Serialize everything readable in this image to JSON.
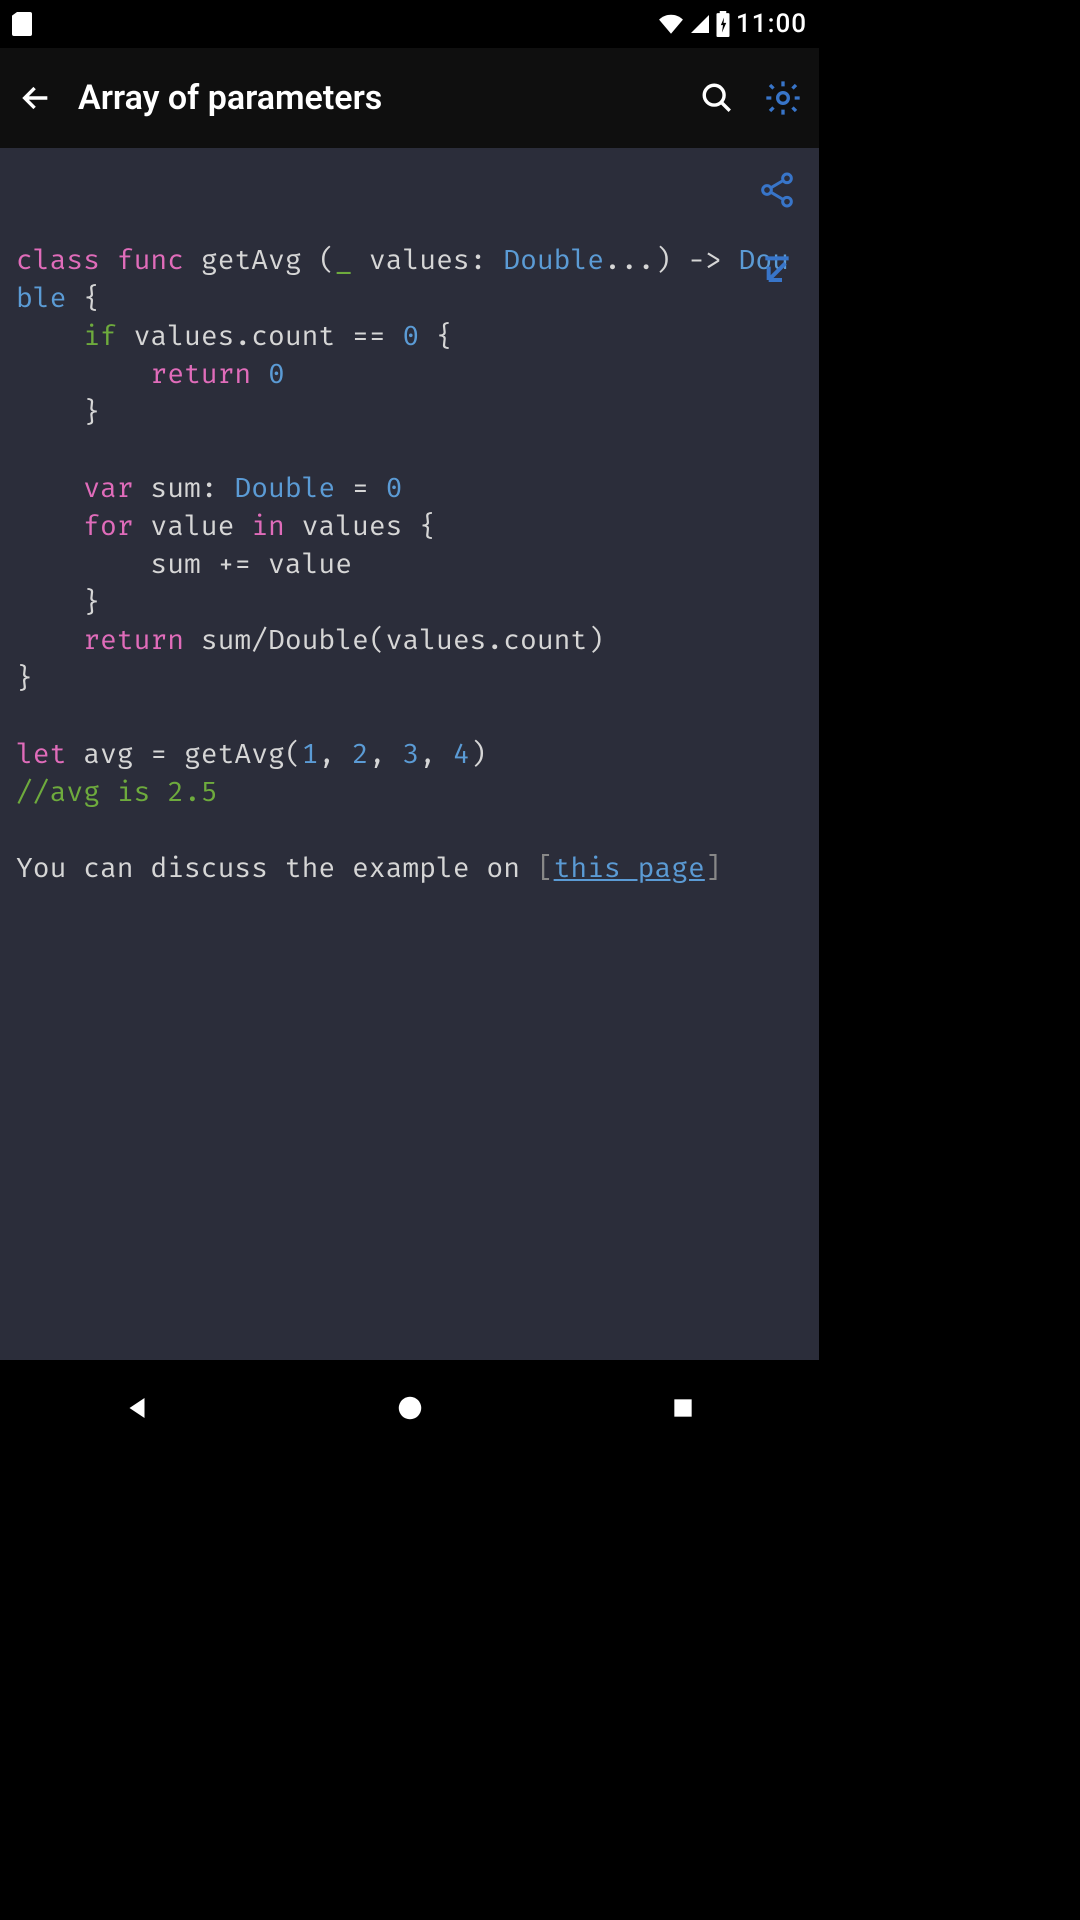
{
  "status": {
    "time": "11:00"
  },
  "header": {
    "title": "Array of parameters"
  },
  "code": {
    "kw_class": "class",
    "kw_func": "func",
    "fn_name": "getAvg",
    "paren_open": " (",
    "underscore": "_",
    "param_name": " values: ",
    "type_double": "Double",
    "ellipsis": "...",
    "arrow_line": ") -> ",
    "brace_open": " {",
    "l2_indent": "    ",
    "kw_if": "if",
    "cond": " values.count == ",
    "zero1": "0",
    "brace2": " {",
    "l3_indent": "        ",
    "kw_return1": "return",
    "sp": " ",
    "zero2": "0",
    "l4_close": "    }",
    "blank": "",
    "kw_var": "var",
    "sum_decl": " sum: ",
    "eq": " = ",
    "zero3": "0",
    "kw_for": "for",
    "for_mid": " value ",
    "kw_in": "in",
    "for_tail": " values {",
    "sum_body": "        sum += value",
    "for_close": "    }",
    "kw_return2": "return",
    "ret_expr": " sum/Double(values.count)",
    "fn_close": "}",
    "kw_let": "let",
    "let_body": " avg = getAvg(",
    "n1": "1",
    "c": ", ",
    "n2": "2",
    "n3": "3",
    "n4": "4",
    "close_paren": ")",
    "comment": "//avg is 2.5",
    "discuss_pre": "You can discuss the example on ",
    "br_open": "[",
    "link_text": "this page",
    "br_close": "]"
  }
}
